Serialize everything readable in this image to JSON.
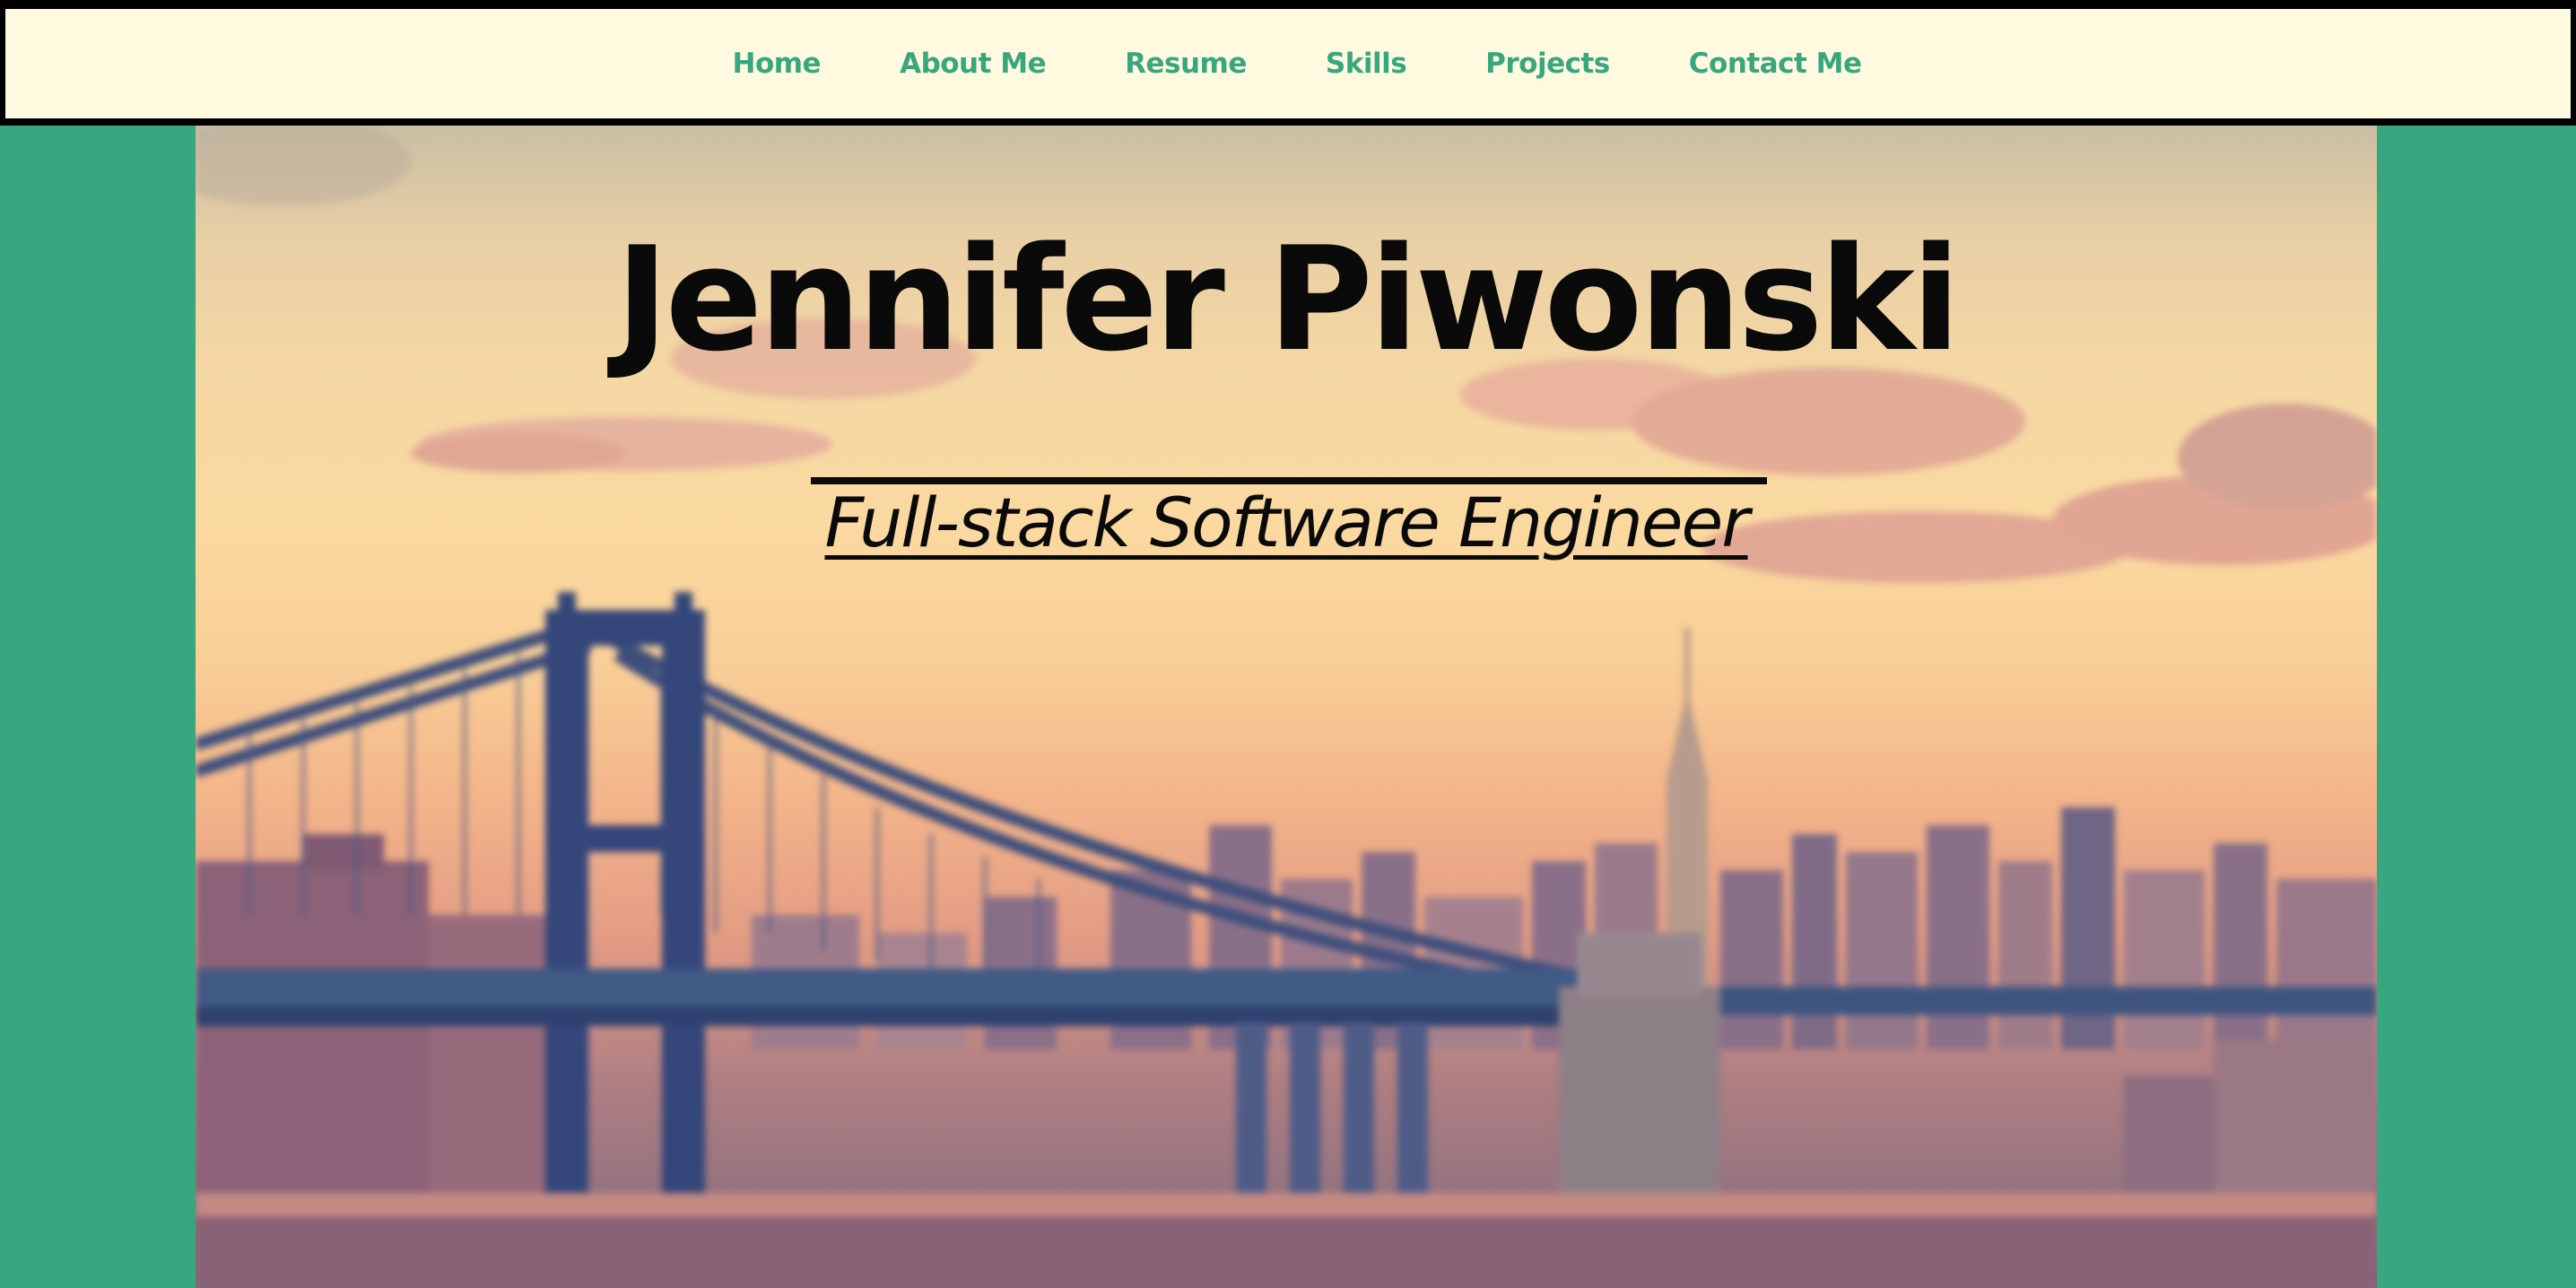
{
  "nav": {
    "items": [
      {
        "label": "Home"
      },
      {
        "label": "About Me"
      },
      {
        "label": "Resume"
      },
      {
        "label": "Skills"
      },
      {
        "label": "Projects"
      },
      {
        "label": "Contact Me"
      }
    ]
  },
  "hero": {
    "title": "Jennifer Piwonski",
    "subtitle": "Full-stack Software Engineer",
    "background_image": "blurred photo of a suspension bridge and city skyline at sunset"
  },
  "colors": {
    "accent": "#38a67e",
    "nav_background": "#fffadf",
    "border": "#000000",
    "text": "#0a0a0a"
  }
}
